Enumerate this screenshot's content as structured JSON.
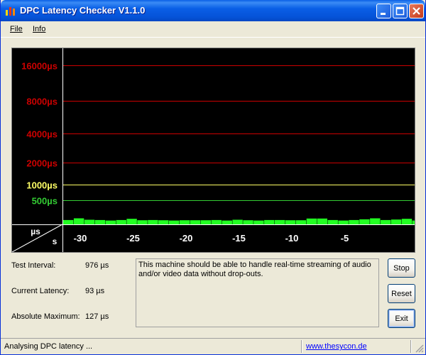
{
  "window": {
    "title": "DPC Latency Checker V1.1.0"
  },
  "menu": {
    "file": "File",
    "info": "Info"
  },
  "colors": {
    "grid_red": "#CC0000",
    "grid_yellow": "#FFFF66",
    "grid_green": "#33CC33",
    "bar_green": "#22FF22"
  },
  "chart_data": {
    "type": "bar",
    "title": "",
    "ylabel": "µs",
    "xlabel": "s",
    "y_scale": "nonlinear (banded)",
    "y_tick_labels": [
      "16000µs",
      "8000µs",
      "4000µs",
      "2000µs",
      "1000µs",
      "500µs"
    ],
    "x_tick_labels": [
      "-30",
      "-25",
      "-20",
      "-15",
      "-10",
      "-5"
    ],
    "grid": true,
    "x": [
      -33,
      -32,
      -31,
      -30,
      -29,
      -28,
      -27,
      -26,
      -25,
      -24,
      -23,
      -22,
      -21,
      -20,
      -19,
      -18,
      -17,
      -16,
      -15,
      -14,
      -13,
      -12,
      -11,
      -10,
      -9,
      -8,
      -7,
      -6,
      -5,
      -4,
      -3,
      -2,
      -1
    ],
    "values": [
      90,
      125,
      95,
      90,
      80,
      90,
      115,
      85,
      90,
      85,
      80,
      85,
      85,
      85,
      90,
      80,
      95,
      85,
      80,
      90,
      90,
      85,
      85,
      120,
      120,
      90,
      80,
      90,
      105,
      125,
      90,
      100,
      115,
      80
    ]
  },
  "stats": {
    "test_interval_label": "Test Interval:",
    "test_interval_value": "976 µs",
    "current_latency_label": "Current Latency:",
    "current_latency_value": "93 µs",
    "absolute_max_label": "Absolute Maximum:",
    "absolute_max_value": "127 µs"
  },
  "message": "This machine should be able to handle real-time streaming of audio and/or video data without drop-outs.",
  "buttons": {
    "stop": "Stop",
    "reset": "Reset",
    "exit": "Exit"
  },
  "status": {
    "text": "Analysing DPC latency ...",
    "link": "www.thesycon.de"
  }
}
